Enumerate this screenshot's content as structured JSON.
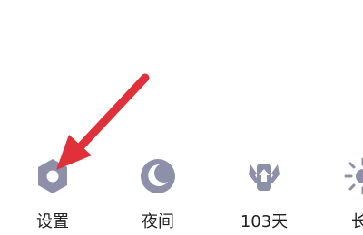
{
  "toolbar": {
    "items": [
      {
        "label": "设置",
        "icon": "settings-hexagon-icon"
      },
      {
        "label": "夜间",
        "icon": "moon-icon"
      },
      {
        "label": "103天",
        "icon": "winged-badge-icon"
      },
      {
        "label": "长",
        "icon": "sun-icon"
      }
    ]
  },
  "colors": {
    "icon": "#8d90a8",
    "label": "#1f1f1f",
    "arrow": "#e0303a"
  }
}
